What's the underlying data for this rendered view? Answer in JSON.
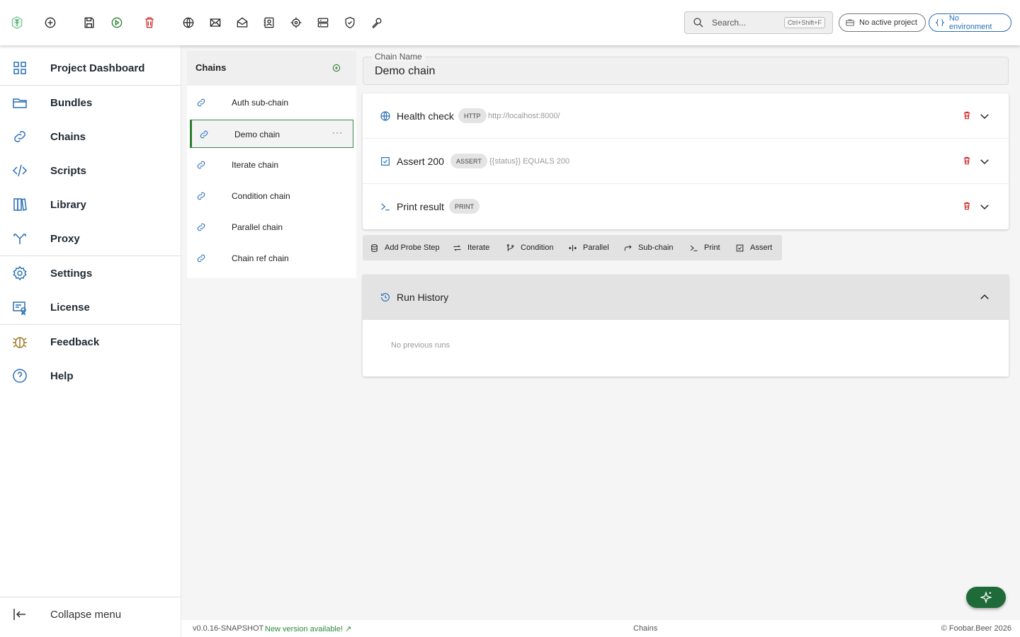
{
  "colors": {
    "accent_green": "#2e7d32",
    "delete_red": "#d32f2f",
    "env_blue": "#2a6fb5",
    "fab_green": "#1e6b39"
  },
  "topbar": {
    "icons": [
      "logo-icon",
      "new-icon",
      "save-icon",
      "run-icon",
      "delete-icon",
      "http-icon",
      "mail-icon",
      "mail-open-icon",
      "contacts-icon",
      "target-icon",
      "server-icon",
      "shield-icon",
      "wrench-icon"
    ],
    "search_placeholder": "Search...",
    "search_shortcut": "Ctrl+Shift+F",
    "project_label": "No active project",
    "environment_label": "No environment"
  },
  "sidebar": {
    "items": [
      {
        "label": "Project Dashboard",
        "icon": "grid-icon"
      },
      {
        "label": "Bundles",
        "icon": "folder-icon"
      },
      {
        "label": "Chains",
        "icon": "link-icon"
      },
      {
        "label": "Scripts",
        "icon": "code-icon"
      },
      {
        "label": "Library",
        "icon": "books-icon"
      },
      {
        "label": "Proxy",
        "icon": "split-icon"
      },
      {
        "label": "Settings",
        "icon": "gear-icon"
      },
      {
        "label": "License",
        "icon": "certificate-icon"
      },
      {
        "label": "Feedback",
        "icon": "bug-icon"
      },
      {
        "label": "Help",
        "icon": "help-icon"
      }
    ],
    "collapse_label": "Collapse menu"
  },
  "chains_panel": {
    "title": "Chains",
    "items": [
      {
        "label": "Auth sub-chain"
      },
      {
        "label": "Demo chain",
        "selected": true,
        "more": "···"
      },
      {
        "label": "Iterate chain"
      },
      {
        "label": "Condition chain"
      },
      {
        "label": "Parallel chain"
      },
      {
        "label": "Chain ref chain"
      }
    ]
  },
  "editor": {
    "name_label": "Chain Name",
    "name_value": "Demo chain",
    "steps": [
      {
        "name": "Health check",
        "type": "HTTP",
        "detail": "http://localhost:8000/",
        "icon": "globe-icon"
      },
      {
        "name": "Assert 200",
        "type": "ASSERT",
        "detail": "{{status}} EQUALS 200",
        "icon": "checkbox-icon"
      },
      {
        "name": "Print result",
        "type": "PRINT",
        "detail": "",
        "icon": "terminal-icon"
      }
    ],
    "toolbar": [
      "Add Probe Step",
      "Iterate",
      "Condition",
      "Parallel",
      "Sub-chain",
      "Print",
      "Assert"
    ],
    "history": {
      "title": "Run History",
      "empty": "No previous runs"
    }
  },
  "footer": {
    "version": "v0.0.16-SNAPSHOT",
    "update": "New version available! ↗",
    "page": "Chains",
    "copyright": "© Foobar.Beer 2026"
  }
}
